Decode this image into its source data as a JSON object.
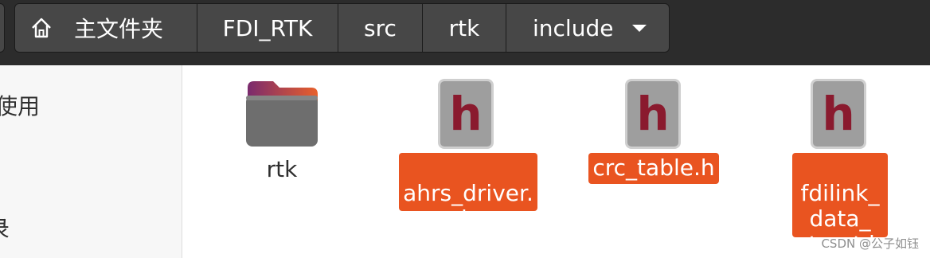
{
  "breadcrumb": {
    "home_label": "主文件夹",
    "items": [
      "FDI_RTK",
      "src",
      "rtk",
      "include"
    ]
  },
  "sidebar": {
    "items": [
      "使用",
      "录"
    ]
  },
  "files": [
    {
      "name": "rtk",
      "type": "folder",
      "selected": false
    },
    {
      "name": "ahrs_driver.\nh",
      "type": "h",
      "icon_letter": "h",
      "selected": true
    },
    {
      "name": "crc_table.h",
      "type": "h",
      "icon_letter": "h",
      "selected": true
    },
    {
      "name": "fdilink_\ndata_\nstruct.h",
      "type": "h",
      "icon_letter": "h",
      "selected": true
    }
  ],
  "watermark": "CSDN @公子如钰",
  "colors": {
    "selection": "#e95420",
    "header": "#2c2c2c",
    "crumb": "#474747",
    "h_letter": "#8a1a2e"
  }
}
